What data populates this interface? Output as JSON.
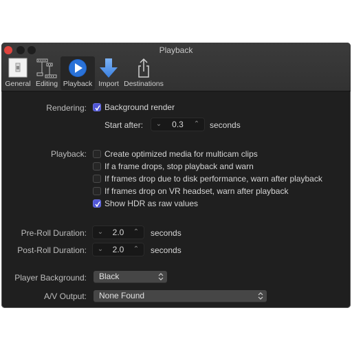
{
  "window": {
    "title": "Playback",
    "controls": [
      "close",
      "minimize",
      "zoom"
    ]
  },
  "toolbar": {
    "tabs": [
      {
        "label": "General",
        "icon": "switch-icon",
        "active": false
      },
      {
        "label": "Editing",
        "icon": "film-strip-icon",
        "active": false
      },
      {
        "label": "Playback",
        "icon": "play-circle-icon",
        "active": true
      },
      {
        "label": "Import",
        "icon": "down-arrow-icon",
        "active": false
      },
      {
        "label": "Destinations",
        "icon": "share-icon",
        "active": false
      }
    ]
  },
  "rendering": {
    "label": "Rendering:",
    "background_render": {
      "label": "Background render",
      "checked": true
    },
    "start_after": {
      "label": "Start after:",
      "value": "0.3",
      "unit": "seconds"
    }
  },
  "playback": {
    "label": "Playback:",
    "options": [
      {
        "label": "Create optimized media for multicam clips",
        "checked": false
      },
      {
        "label": "If a frame drops, stop playback and warn",
        "checked": false
      },
      {
        "label": "If frames drop due to disk performance, warn after playback",
        "checked": false
      },
      {
        "label": "If frames drop on VR headset, warn after playback",
        "checked": false
      },
      {
        "label": "Show HDR as raw values",
        "checked": true
      }
    ]
  },
  "pre_roll": {
    "label": "Pre-Roll Duration:",
    "value": "2.0",
    "unit": "seconds"
  },
  "post_roll": {
    "label": "Post-Roll Duration:",
    "value": "2.0",
    "unit": "seconds"
  },
  "player_background": {
    "label": "Player Background:",
    "value": "Black"
  },
  "av_output": {
    "label": "A/V Output:",
    "value": "None Found"
  },
  "colors": {
    "accent": "#5056d6",
    "close_button": "#e0443e",
    "background": "#1f1f1f"
  }
}
